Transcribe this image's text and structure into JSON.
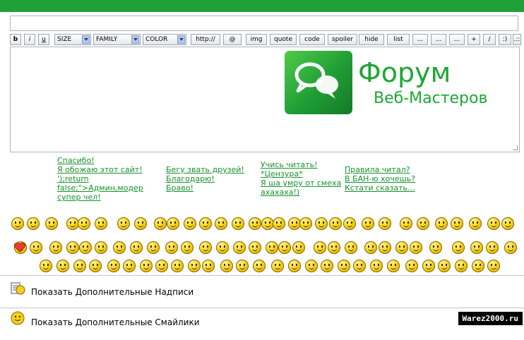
{
  "toolbar": {
    "buttons": [
      "b",
      "i",
      "u",
      "http://",
      "@",
      "img",
      "quote",
      "code",
      "spoiler",
      "hide",
      "list",
      "...",
      "...",
      "...",
      "+",
      "/",
      ":)",
      ".::"
    ],
    "selects": [
      "SIZE",
      "FAMILY",
      "COLOR"
    ]
  },
  "logo": {
    "title": "Форум",
    "subtitle": "Веб-Мастеров"
  },
  "phrases": {
    "col1": [
      "Спасибо!",
      "Я обожаю этот сайт!",
      "');return",
      "false;\">Админ,модер",
      "супер чел!"
    ],
    "col2": [
      "Бегу звать друзей!",
      "Благодарю!",
      "Браво!"
    ],
    "col3": [
      "Учись читать!",
      "*Цензура*",
      "Я ша умру от смеха",
      "ахахаха!)"
    ],
    "col4": [
      "Правила читал?",
      "В БАН-ю хочешь?",
      "Кстати сказать..."
    ]
  },
  "rows": {
    "extra_captions": "Показать Дополнительные Надписи",
    "extra_smilies": "Показать Дополнительные Смайлики"
  },
  "watermark": "Warez2000.ru",
  "colors": {
    "brand_green": "#1fa13a",
    "link_green": "#17922d"
  }
}
